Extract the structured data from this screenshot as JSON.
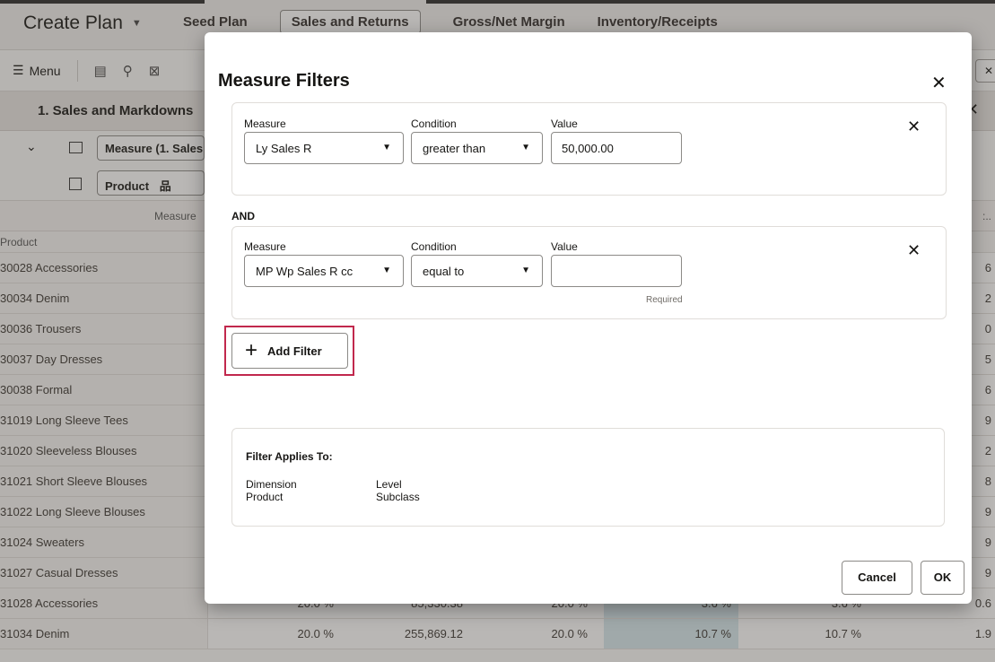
{
  "app": {
    "title": "Create Plan",
    "tabs": [
      "Seed Plan",
      "Sales and Returns",
      "Gross/Net Margin",
      "Inventory/Receipts"
    ],
    "active_tab": "Sales and Returns",
    "menu_label": "Menu",
    "pane_title": "1. Sales and Markdowns",
    "measure_pill": "Measure (1. Sales",
    "product_pill": "Product",
    "measure_col_label": "Measure",
    "row_header_label": "Product",
    "rows": [
      {
        "name": "30028 Accessories",
        "last": "6"
      },
      {
        "name": "30034 Denim",
        "last": "2"
      },
      {
        "name": "30036 Trousers",
        "last": "0"
      },
      {
        "name": "30037 Day Dresses",
        "last": "5"
      },
      {
        "name": "30038 Formal",
        "last": "6"
      },
      {
        "name": "31019 Long Sleeve Tees",
        "last": "9"
      },
      {
        "name": "31020 Sleeveless Blouses",
        "last": "2"
      },
      {
        "name": "31021 Short Sleeve Blouses",
        "last": "8"
      },
      {
        "name": "31022 Long Sleeve Blouses",
        "last": "9"
      },
      {
        "name": "31024 Sweaters",
        "last": "9"
      },
      {
        "name": "31027 Casual Dresses",
        "last": "9"
      }
    ],
    "full_rows": [
      {
        "name": "31028 Accessories",
        "c1": "20.0 %",
        "c2": "85,330.38",
        "c3": "20.0 %",
        "c4": "3.6 %",
        "c5": "3.6 %",
        "c6": "0.6"
      },
      {
        "name": "31034 Denim",
        "c1": "20.0 %",
        "c2": "255,869.12",
        "c3": "20.0 %",
        "c4": "10.7 %",
        "c5": "10.7 %",
        "c6": "1.9"
      }
    ]
  },
  "dialog": {
    "title": "Measure Filters",
    "and_label": "AND",
    "filters": [
      {
        "measure_label": "Measure",
        "measure_value": "Ly Sales R",
        "condition_label": "Condition",
        "condition_value": "greater than",
        "value_label": "Value",
        "value": "50,000.00",
        "hint": ""
      },
      {
        "measure_label": "Measure",
        "measure_value": "MP Wp Sales R cc",
        "condition_label": "Condition",
        "condition_value": "equal to",
        "value_label": "Value",
        "value": "",
        "hint": "Required"
      }
    ],
    "add_filter_label": "Add Filter",
    "applies_title": "Filter Applies To:",
    "dimension_label": "Dimension",
    "dimension_value": "Product",
    "level_label": "Level",
    "level_value": "Subclass",
    "cancel_label": "Cancel",
    "ok_label": "OK"
  },
  "colors": {
    "highlight": "#c1284d",
    "shade": "#d7e8ed"
  }
}
